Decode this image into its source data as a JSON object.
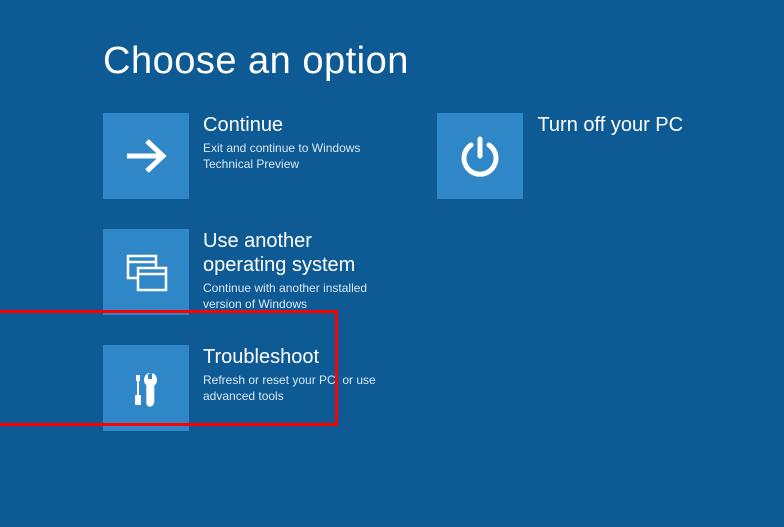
{
  "title": "Choose an option",
  "options": {
    "continue": {
      "title": "Continue",
      "desc": "Exit and continue to Windows Technical Preview"
    },
    "another_os": {
      "title": "Use another operating system",
      "desc": "Continue with another installed version of Windows"
    },
    "troubleshoot": {
      "title": "Troubleshoot",
      "desc": "Refresh or reset your PC, or use advanced tools"
    },
    "turn_off": {
      "title": "Turn off your PC",
      "desc": ""
    }
  },
  "colors": {
    "background": "#0e5a94",
    "tile": "#2f87c7",
    "highlight": "#ff0000"
  }
}
